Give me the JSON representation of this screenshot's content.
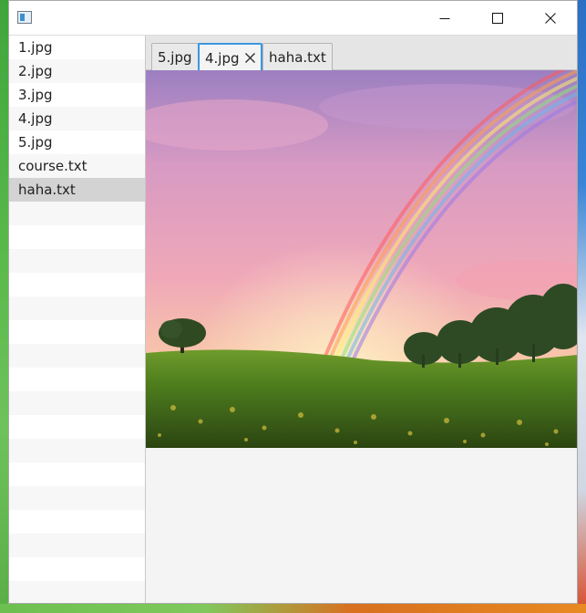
{
  "window": {
    "title": "",
    "icons": {
      "app": "app-window-icon",
      "minimize": "minimize-icon",
      "maximize": "maximize-icon",
      "close": "close-icon"
    }
  },
  "file_list": {
    "items": [
      "1.jpg",
      "2.jpg",
      "3.jpg",
      "4.jpg",
      "5.jpg",
      "course.txt",
      "haha.txt"
    ],
    "selected": "haha.txt"
  },
  "tabs": [
    {
      "label": "5.jpg",
      "active": false
    },
    {
      "label": "4.jpg",
      "active": true
    },
    {
      "label": "haha.txt",
      "active": false
    }
  ],
  "viewer": {
    "content": "landscape-rainbow-image"
  }
}
